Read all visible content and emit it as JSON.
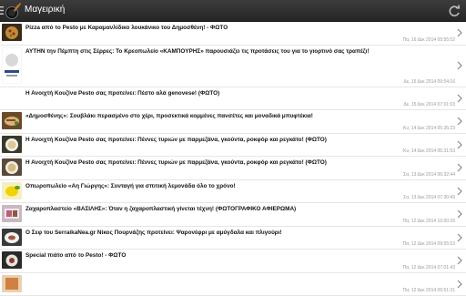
{
  "header": {
    "title": "Μαγειρική"
  },
  "articles": [
    {
      "title": "Pizza από το Pesto με Καραμανλίδικο λουκάνικο του Δημοσθένη! - ΦΩΤΟ",
      "date": "Πα, 16 Δεκ 2014 05:55:52"
    },
    {
      "title": "ΑΥΤΗΝ την Πέμπτη στις Σέρρες: Το Κρεοπωλείο «ΚΑΜΠΟΥΡΗΣ» παρουσιάζει τις προτάσεις του για το γιορτινό σας τραπέζι!",
      "date": "Δε, 15 Δεκ 2014 09:54:16"
    },
    {
      "title": "Η Ανοιχτή Κουζίνα Pesto σας προτείνει: Πέστο αλά genovese! (ΦΩΤΟ)",
      "date": "Δε, 15 Δεκ 2014 07:01:03"
    },
    {
      "title": "«Δημοσθένης»: Σουβλάκι περασμένο στο χέρι, προσεκτικά κομμένες πανσέτες και μοναδικά μπυφτέκια!",
      "date": "Κυ, 14 Δεκ 2014 05:35:23"
    },
    {
      "title": "Η Ανοιχτή Κουζίνα Pesto σας προτείνει: Πέννες τυριών με παρμεζάνα, γκούντα, ροκφόρ και ρεγκάτο! (ΦΩΤΟ)",
      "date": "Κυ, 14 Δεκ 2014 05:31:53"
    },
    {
      "title": "Η Ανοιχτή Κουζίνα Pesto σας προτείνει: Πέννες τυριών με παρμεζάνα, γκούντα, ροκφόρ και ρεγκάτο! (ΦΩΤΟ)",
      "date": "Σα, 13 Δεκ 2014 06:32:44"
    },
    {
      "title": "Οπωροπωλείο «Αη Γιώργης»: Συνταγή για σπιτική λεμονάδα όλο το χρόνο!",
      "date": "Σα, 13 Δεκ 2014 07:30:49"
    },
    {
      "title": "Ζαχαροπλαστείο «ΒΑΣΙΛΗΣ»: Όταν η ζαχαροπλαστική γίνεται τέχνη! (ΦΩΤΟΓΡΑΦΙΚΟ ΑΦΙΕΡΩΜΑ)",
      "date": "Πα, 12 Δεκ 2014 10:00:29"
    },
    {
      "title": "Ο Σεφ του SerraikaNea.gr Νίκος Πουρνάζης προτείνει: Ψαρονέφρι με αμύγδαλα και πλιγούρι!",
      "date": "Πα, 12 Δεκ 2014 09:55:53"
    },
    {
      "title": "Special πιάτο από το Pesto! - ΦΩΤΟ",
      "date": "Πα, 12 Δεκ 2014 07:01:43"
    },
    {
      "title": "",
      "date": "Πα, 12 Δεκ 2014 06:51:31"
    }
  ],
  "colors": {
    "topbar": "#2f2f2f",
    "title_text": "#111111",
    "date_text": "#9a9a9a",
    "chevron": "#888888"
  }
}
